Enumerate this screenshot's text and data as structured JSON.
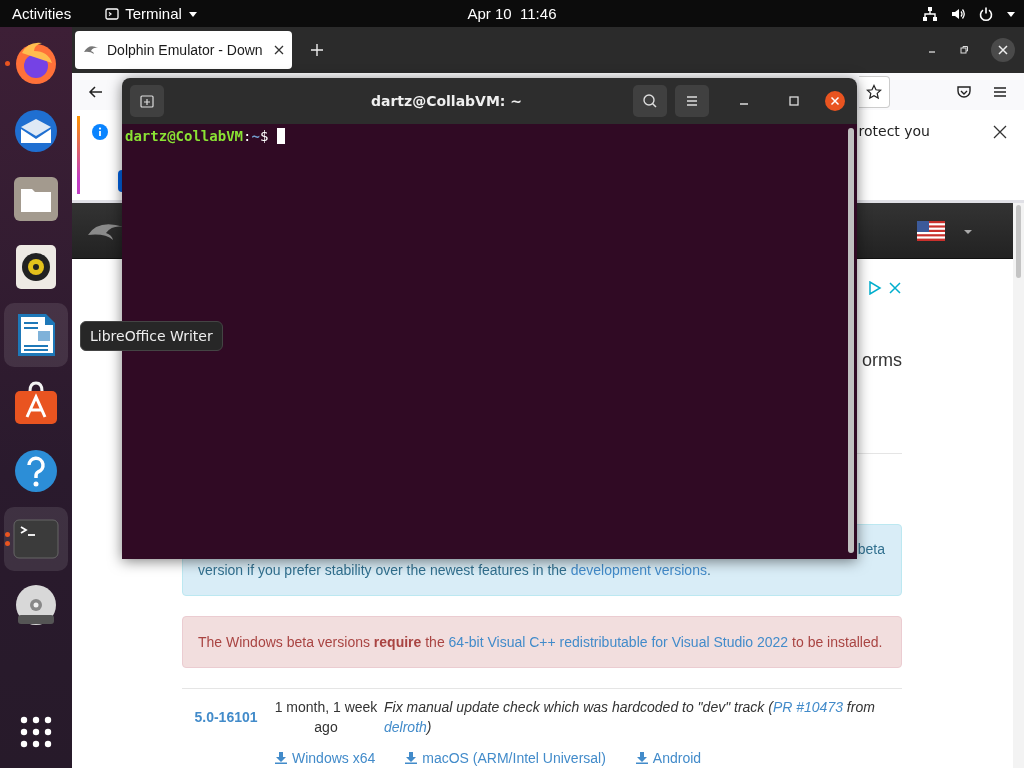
{
  "top_bar": {
    "activities": "Activities",
    "app_menu": {
      "label": "Terminal"
    },
    "clock": "Apr 10  11:46"
  },
  "dock": {
    "items": [
      {
        "kind": "firefox",
        "running": true,
        "several_windows": false,
        "highlighted": false
      },
      {
        "kind": "thunderbird",
        "running": false,
        "several_windows": false,
        "highlighted": false
      },
      {
        "kind": "files",
        "running": false,
        "several_windows": false,
        "highlighted": false
      },
      {
        "kind": "rhythmbox",
        "running": false,
        "several_windows": false,
        "highlighted": false
      },
      {
        "kind": "writer",
        "running": false,
        "several_windows": false,
        "highlighted": true
      },
      {
        "kind": "software",
        "running": false,
        "several_windows": false,
        "highlighted": false
      },
      {
        "kind": "help",
        "running": false,
        "several_windows": false,
        "highlighted": false
      },
      {
        "kind": "terminal",
        "running": true,
        "several_windows": true,
        "highlighted": true
      },
      {
        "kind": "dvd",
        "running": false,
        "several_windows": false,
        "highlighted": false
      }
    ]
  },
  "tooltip": {
    "text": "LibreOffice Writer"
  },
  "browser": {
    "tabs": [
      {
        "title": "Dolphin Emulator - Down",
        "selected": true
      }
    ],
    "notification": {
      "text_right": "rotect you"
    },
    "page": {
      "heading_fragment": "orms",
      "info_alert": {
        "line_1": "beta",
        "line_2": [
          {
            "kind": "text",
            "text": "version if you prefer stability over the newest features in the "
          },
          {
            "kind": "link",
            "text": "development versions"
          },
          {
            "kind": "text",
            "text": "."
          }
        ]
      },
      "warning_alert": {
        "parts": [
          {
            "kind": "text",
            "text": "The Windows beta versions **require** the "
          },
          {
            "kind": "link",
            "text": "64-bit Visual C++ redistributable for Visual Studio 2022"
          },
          {
            "kind": "text",
            "text": " to be installed."
          }
        ]
      },
      "builds": [
        {
          "version": "5.0-16101",
          "date": "1 month, 1 week ago",
          "description": [
            {
              "kind": "text",
              "text": "Fix manual update check which was hardcoded to \"dev\" track ("
            },
            {
              "kind": "link",
              "text": "PR #10473"
            },
            {
              "kind": "text",
              "text": " from "
            },
            {
              "kind": "link",
              "text": "delroth"
            },
            {
              "kind": "text",
              "text": ")"
            }
          ],
          "downloads": [
            "Windows x64",
            "macOS (ARM/Intel Universal)",
            "Android"
          ]
        }
      ]
    }
  },
  "terminal": {
    "title": "dartz@CollabVM: ~",
    "prompt": {
      "user_host": "dartz@CollabVM",
      "separator": ":",
      "path": "~",
      "symbol": "$"
    }
  }
}
